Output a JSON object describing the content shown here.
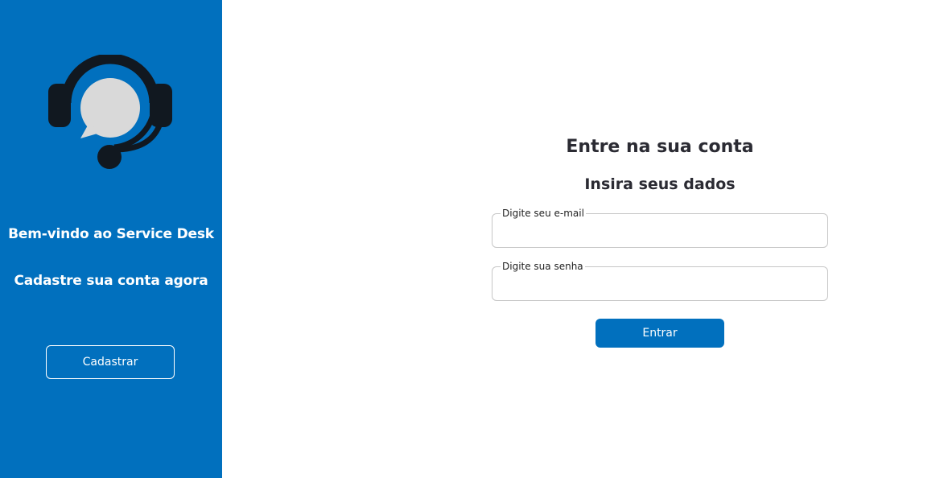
{
  "sidebar": {
    "logo_icon": "headset-chat-icon",
    "welcome_title": "Bem-vindo ao Service Desk",
    "welcome_subtitle": "Cadastre sua conta agora",
    "register_label": "Cadastrar"
  },
  "login": {
    "title": "Entre na sua conta",
    "subtitle": "Insira seus dados",
    "email": {
      "label": "Digite seu e-mail",
      "value": ""
    },
    "password": {
      "label": "Digite sua senha",
      "value": ""
    },
    "submit_label": "Entrar"
  },
  "colors": {
    "brand_blue": "#0170be",
    "logo_dark": "#111820",
    "bubble_gray": "#d9d9d9"
  }
}
